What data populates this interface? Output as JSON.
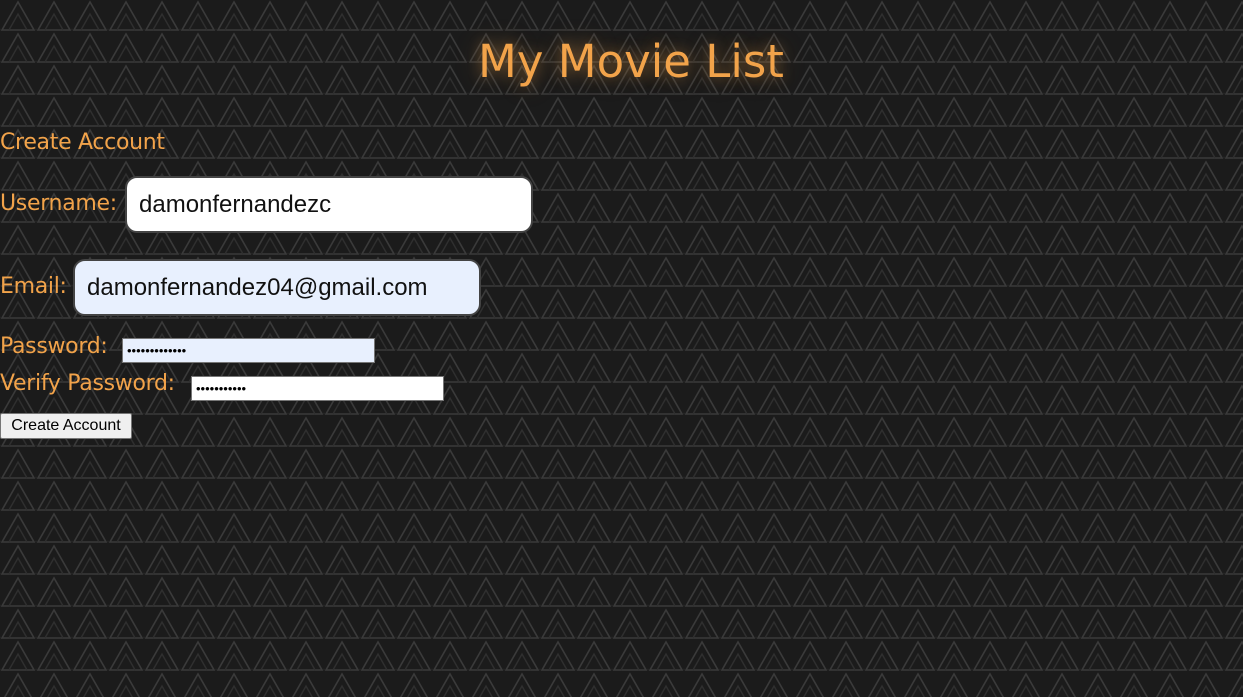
{
  "header": {
    "title": "My Movie List"
  },
  "form": {
    "heading": "Create Account",
    "username": {
      "label": "Username:",
      "value": "damonfernandezc"
    },
    "email": {
      "label": "Email:",
      "value": "damonfernandez04@gmail.com"
    },
    "password": {
      "label": "Password:",
      "value": "•••••••••••••"
    },
    "verify_password": {
      "label": "Verify Password:",
      "value": "•••••••••••"
    },
    "submit_label": "Create Account"
  },
  "theme": {
    "background": "#1b1b1b",
    "pattern_line": "#3a3a3a",
    "accent": "#f2a34a",
    "autofill_fill": "#e8f0fe"
  }
}
